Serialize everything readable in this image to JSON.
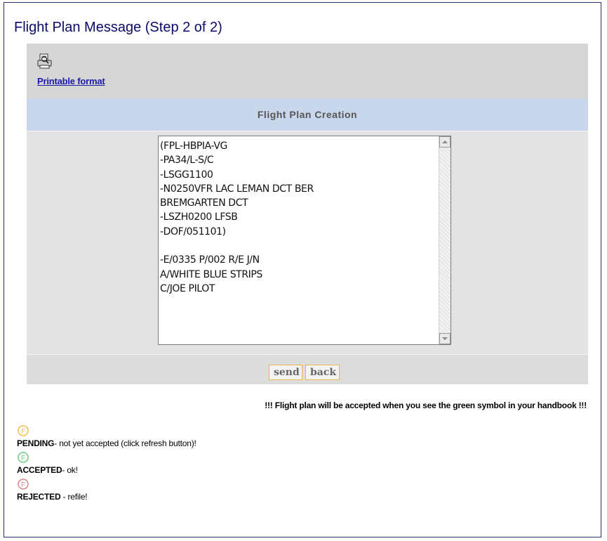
{
  "page": {
    "title": "Flight Plan Message (Step 2 of 2)"
  },
  "toolbar": {
    "print_icon": "printer-icon",
    "printable_label": "Printable format"
  },
  "section": {
    "title": "Flight Plan Creation"
  },
  "message": {
    "value": "(FPL-HBPIA-VG\n-PA34/L-S/C\n-LSGG1100\n-N0250VFR LAC LEMAN DCT BER\nBREMGARTEN DCT\n-LSZH0200 LFSB\n-DOF/051101)\n\n-E/0335 P/002 R/E J/N\nA/WHITE BLUE STRIPS\nC/JOE PILOT"
  },
  "buttons": {
    "send": "send",
    "back": "back"
  },
  "notice": "!!! Flight plan will be accepted when you see the green symbol in your handbook !!!",
  "legend": {
    "pending_label": "PENDING",
    "pending_desc": "- not yet accepted (click refresh button)!",
    "accepted_label": "ACCEPTED",
    "accepted_desc": "- ok!",
    "rejected_label": "REJECTED",
    "rejected_desc": " - refile!",
    "symbol_letter": "F"
  },
  "colors": {
    "pending": "#f0c04a",
    "accepted": "#6ccf7f",
    "rejected": "#d98a8a",
    "button_border": "#f0b64a",
    "title": "#0a0a6a"
  }
}
